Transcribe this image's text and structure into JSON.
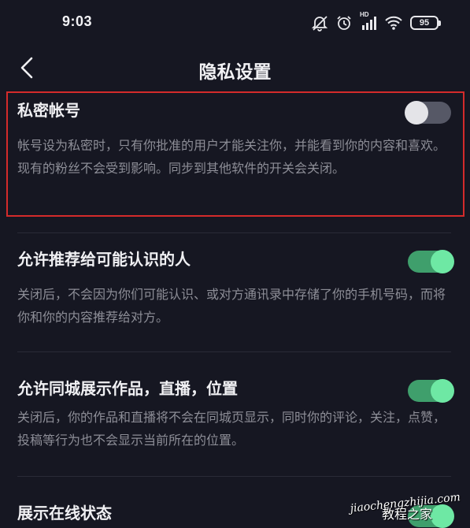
{
  "status_bar": {
    "time": "9:03",
    "network_label": "HD",
    "battery_level": "95",
    "icons": [
      "mute-bell-icon",
      "alarm-icon",
      "signal-icon",
      "wifi-icon",
      "battery-icon"
    ]
  },
  "header": {
    "title": "隐私设置",
    "back_icon": "chevron-left-icon"
  },
  "settings": [
    {
      "title": "私密帐号",
      "description": "帐号设为私密时，只有你批准的用户才能关注你，并能看到你的内容和喜欢。现有的粉丝不会受到影响。同步到其他软件的开关会关闭。",
      "enabled": false
    },
    {
      "title": "允许推荐给可能认识的人",
      "description": "关闭后，不会因为你们可能认识、或对方通讯录中存储了你的手机号码，而将你和你的内容推荐给对方。",
      "enabled": true
    },
    {
      "title": "允许同城展示作品，直播，位置",
      "description": "关闭后，你的作品和直播将不会在同城页显示，同时你的评论，关注，点赞，投稿等行为也不会显示当前所在的位置。",
      "enabled": true
    },
    {
      "title": "展示在线状态",
      "description": "",
      "enabled": true
    }
  ],
  "watermark": {
    "url": "jiaochengzhijia.com",
    "text": "教程之家"
  },
  "colors": {
    "background": "#161722",
    "toggle_on": "#3f9f6c",
    "toggle_on_knob": "#6ee8a4",
    "toggle_off": "#565866",
    "highlight": "#d42b2b"
  }
}
